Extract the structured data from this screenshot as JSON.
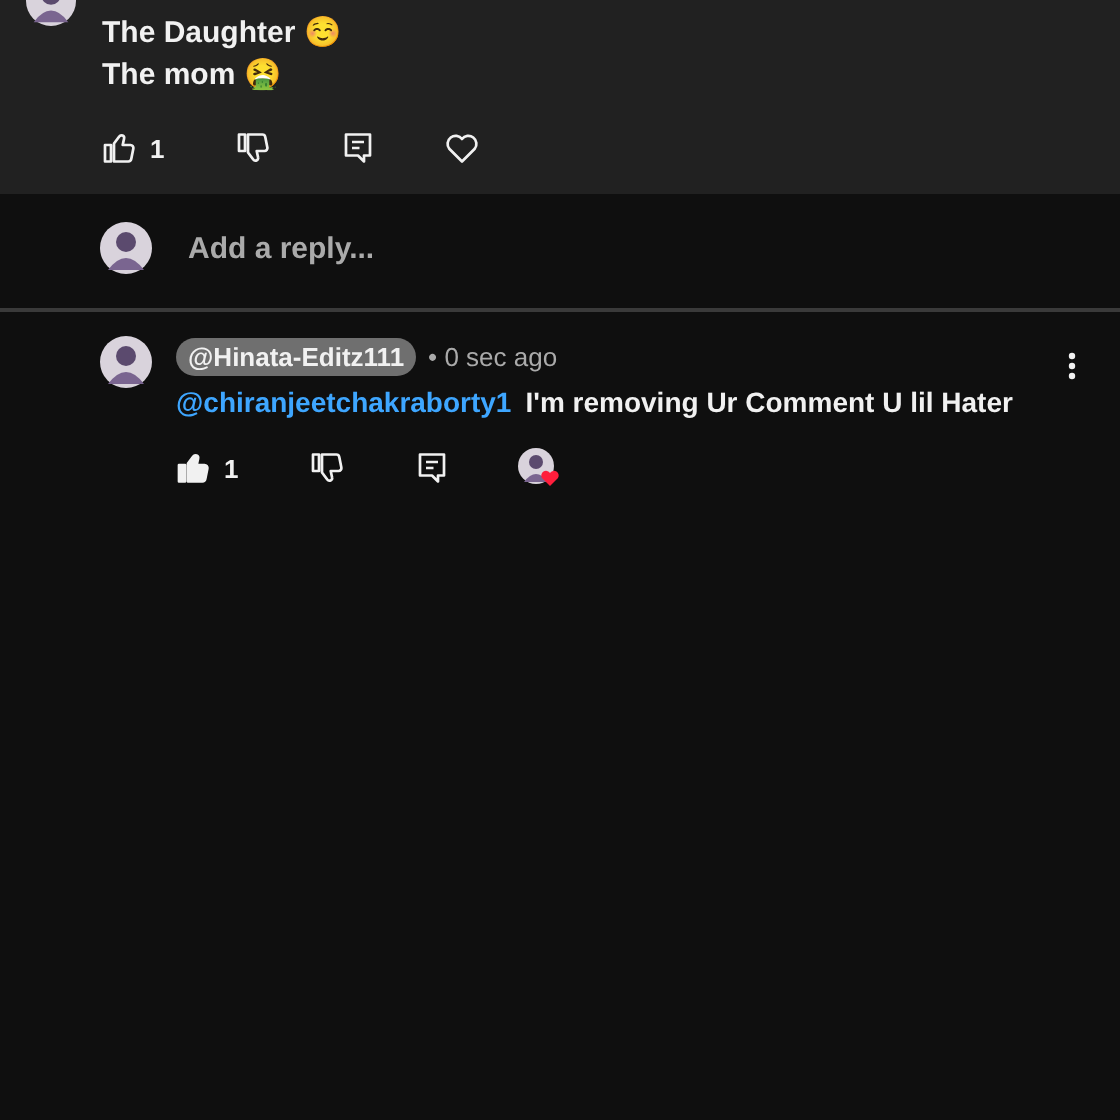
{
  "comments": [
    {
      "kind": "top",
      "lines": [
        "The Daughter ☺️",
        "The mom 🤮"
      ],
      "like_count": "1",
      "liked": false,
      "hearted": false
    },
    {
      "kind": "reply",
      "author": "@Hinata-Editz111",
      "time": "• 0 sec ago",
      "mention": "@chiranjeetchakraborty1",
      "text": "I'm removing Ur Comment U lil Hater",
      "like_count": "1",
      "liked": true,
      "hearted": true
    }
  ],
  "reply_field": {
    "placeholder": "Add a reply..."
  }
}
